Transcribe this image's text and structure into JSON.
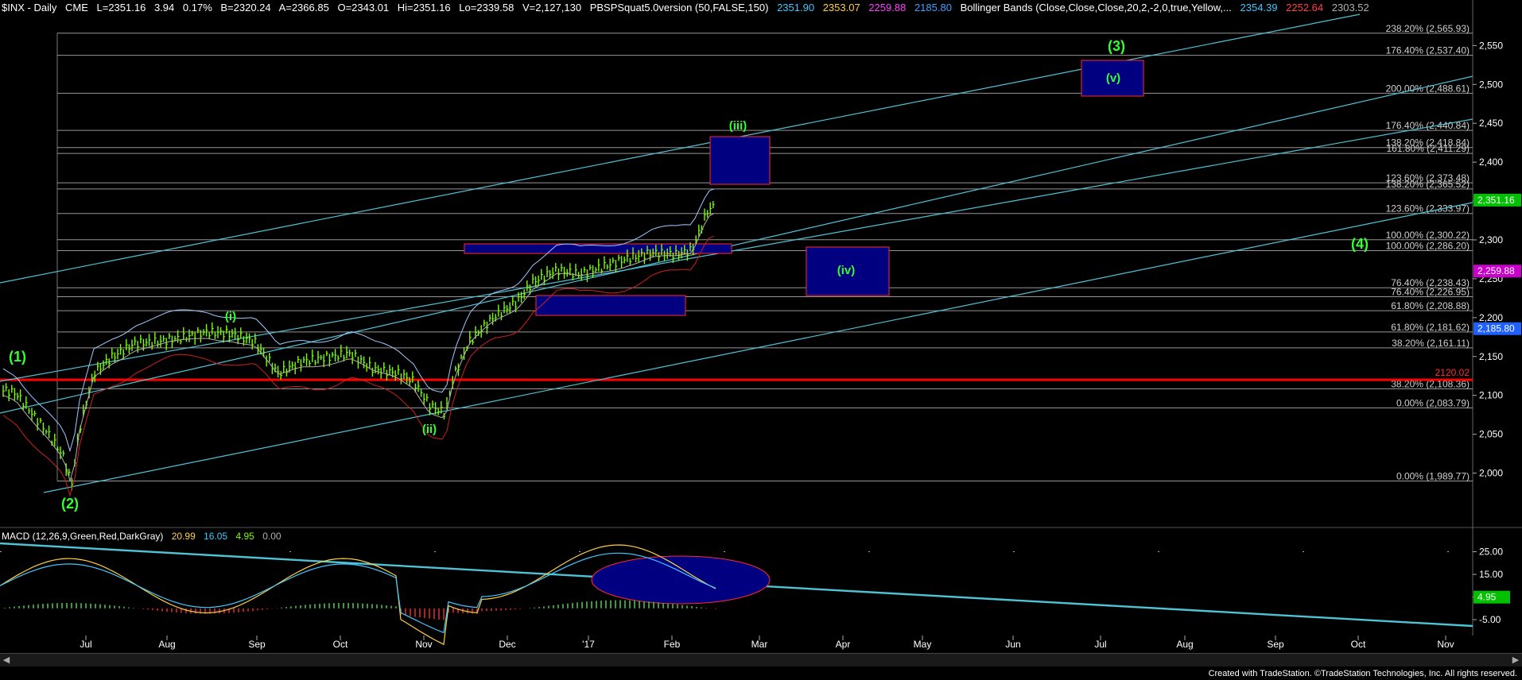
{
  "header": {
    "symbol": "$INX - Daily",
    "exchange": "CME",
    "last": "L=2351.16",
    "change": "3.94",
    "pct": "0.17%",
    "bid": "B=2320.24",
    "ask": "A=2366.85",
    "open": "O=2343.01",
    "high": "Hi=2351.16",
    "low": "Lo=2339.58",
    "volume": "V=2,127,130",
    "indicator": "PBSPSquat5.0version (50,FALSE,150)",
    "ind_v1": "2351.90",
    "ind_v2": "2353.07",
    "ind_v3": "2259.88",
    "ind_v4": "2185.80",
    "bb_label": "Bollinger Bands (Close,Close,Close,20,2,-2,0,true,Yellow,...",
    "bb_v1": "2354.39",
    "bb_v2": "2252.64",
    "bb_v3": "2303.52"
  },
  "macd_header": {
    "label": "MACD (12,26,9,Green,Red,DarkGray)",
    "v1": "20.99",
    "v2": "16.05",
    "v3": "4.95",
    "v4": "0.00"
  },
  "footer": "Created with TradeStation. ©TradeStation Technologies, Inc. All rights reserved.",
  "colors": {
    "background": "#000000",
    "bar": "#7cfc00",
    "fib_line": "#c8c8c8",
    "channel": "#4fc3d6",
    "box_fill": "#000080",
    "box_border": "#ff2a2a",
    "wave_label": "#33ff33",
    "support": "#ff0000"
  },
  "chart_data": {
    "type": "candlestick",
    "price_axis_ticks": [
      "2,550",
      "2,500",
      "2,450",
      "2,400",
      "2,350",
      "2,300",
      "2,250",
      "2,200",
      "2,150",
      "2,100",
      "2,050",
      "2,000"
    ],
    "ylim": [
      1975,
      2580
    ],
    "time_axis_ticks": [
      "Jul",
      "Aug",
      "Sep",
      "Oct",
      "Nov",
      "Dec",
      "'17",
      "Feb",
      "Mar",
      "Apr",
      "May",
      "Jun",
      "Jul",
      "Aug",
      "Sep",
      "Oct",
      "Nov"
    ],
    "fib_levels": [
      {
        "label": "238.20% (2,565.93)",
        "value": 2565.93
      },
      {
        "label": "176.40% (2,537.40)",
        "value": 2537.4
      },
      {
        "label": "200.00% (2,488.61)",
        "value": 2488.61
      },
      {
        "label": "176.40% (2,440.84)",
        "value": 2440.84
      },
      {
        "label": "138.20% (2,418.84)",
        "value": 2418.84
      },
      {
        "label": "161.80% (2,411.29)",
        "value": 2411.29
      },
      {
        "label": "123.60% (2,373.48)",
        "value": 2373.48
      },
      {
        "label": "138.20% (2,365.52)",
        "value": 2365.52
      },
      {
        "label": "123.60% (2,333.97)",
        "value": 2333.97
      },
      {
        "label": "100.00% (2,300.22)",
        "value": 2300.22
      },
      {
        "label": "100.00% (2,286.20)",
        "value": 2286.2
      },
      {
        "label": "76.40% (2,238.43)",
        "value": 2238.43
      },
      {
        "label": "76.40% (2,226.95)",
        "value": 2226.95
      },
      {
        "label": "61.80% (2,208.88)",
        "value": 2208.88
      },
      {
        "label": "61.80% (2,181.62)",
        "value": 2181.62
      },
      {
        "label": "38.20% (2,161.11)",
        "value": 2161.11
      },
      {
        "label": "38.20% (2,108.36)",
        "value": 2108.36
      },
      {
        "label": "0.00% (2,083.79)",
        "value": 2083.79
      },
      {
        "label": "0.00% (1,989.77)",
        "value": 1989.77
      }
    ],
    "support_level": {
      "label": "2120.02",
      "value": 2120.02
    },
    "price_tags": [
      {
        "label": "2,351.16",
        "value": 2351.16,
        "color": "#00c000"
      },
      {
        "label": "2,259.88",
        "value": 2259.88,
        "color": "#cc00cc"
      },
      {
        "label": "2,185.80",
        "value": 2185.8,
        "color": "#2060ff"
      }
    ],
    "wave_labels": [
      "(1)",
      "(2)",
      "(i)",
      "(ii)",
      "(iii)",
      "(iv)",
      "(v)",
      "(3)",
      "(4)"
    ],
    "macd": {
      "ticks": [
        "25.00",
        "15.00",
        "5.00",
        "-5.00"
      ],
      "tags": [
        {
          "label": "4.95",
          "color": "#00c000"
        }
      ],
      "ylim": [
        -12,
        28
      ]
    }
  }
}
